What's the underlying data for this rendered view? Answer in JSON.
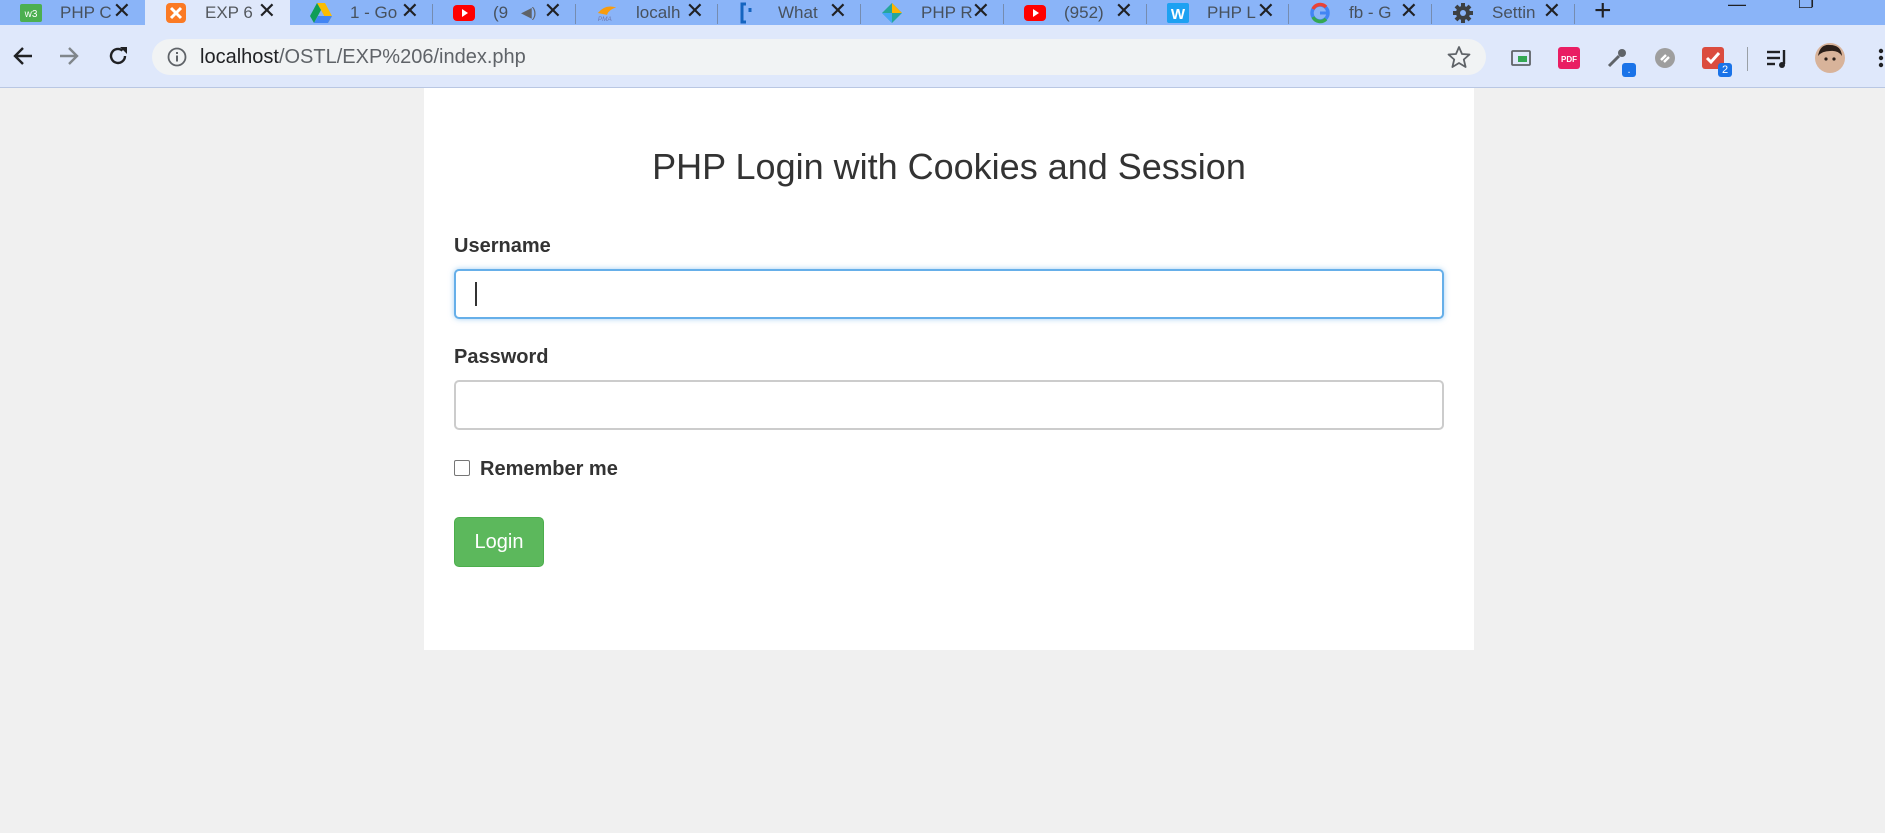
{
  "browser": {
    "tabs": [
      {
        "title": "PHP C",
        "icon": "w3schools-icon",
        "active": false
      },
      {
        "title": "EXP 6",
        "icon": "xampp-icon",
        "active": true
      },
      {
        "title": "1 - Go",
        "icon": "google-drive-icon",
        "active": false
      },
      {
        "title": "(9",
        "icon": "youtube-icon",
        "active": false
      },
      {
        "title": "localh",
        "icon": "phpmyadmin-icon",
        "active": false
      },
      {
        "title": "What",
        "icon": "bracket-icon",
        "active": false
      },
      {
        "title": "PHP R",
        "icon": "kite-icon",
        "active": false
      },
      {
        "title": "(952)",
        "icon": "youtube-icon",
        "active": false
      },
      {
        "title": "PHP L",
        "icon": "wordpress-icon",
        "active": false
      },
      {
        "title": "fb - G",
        "icon": "google-icon",
        "active": false
      },
      {
        "title": "Settin",
        "icon": "gear-icon",
        "active": false
      }
    ],
    "address": {
      "host": "localhost",
      "path": "/OSTL/EXP%206/index.php"
    },
    "extensions": [
      {
        "icon": "cast-icon"
      },
      {
        "icon": "pdf-icon"
      },
      {
        "icon": "eyedropper-icon",
        "badge": "."
      },
      {
        "icon": "clipper-icon"
      },
      {
        "icon": "todoist-icon",
        "badge": "2"
      },
      {
        "icon": "playlist-icon"
      },
      {
        "icon": "avatar-icon"
      }
    ]
  },
  "page": {
    "title": "PHP Login with Cookies and Session",
    "username_label": "Username",
    "username_value": "",
    "password_label": "Password",
    "password_value": "",
    "remember_label": "Remember me",
    "login_label": "Login"
  },
  "colors": {
    "tabstrip": "#8ab4f8",
    "toolbar": "#dfe8fb",
    "login_button": "#5cb85c",
    "focus_border": "#66afe9"
  }
}
